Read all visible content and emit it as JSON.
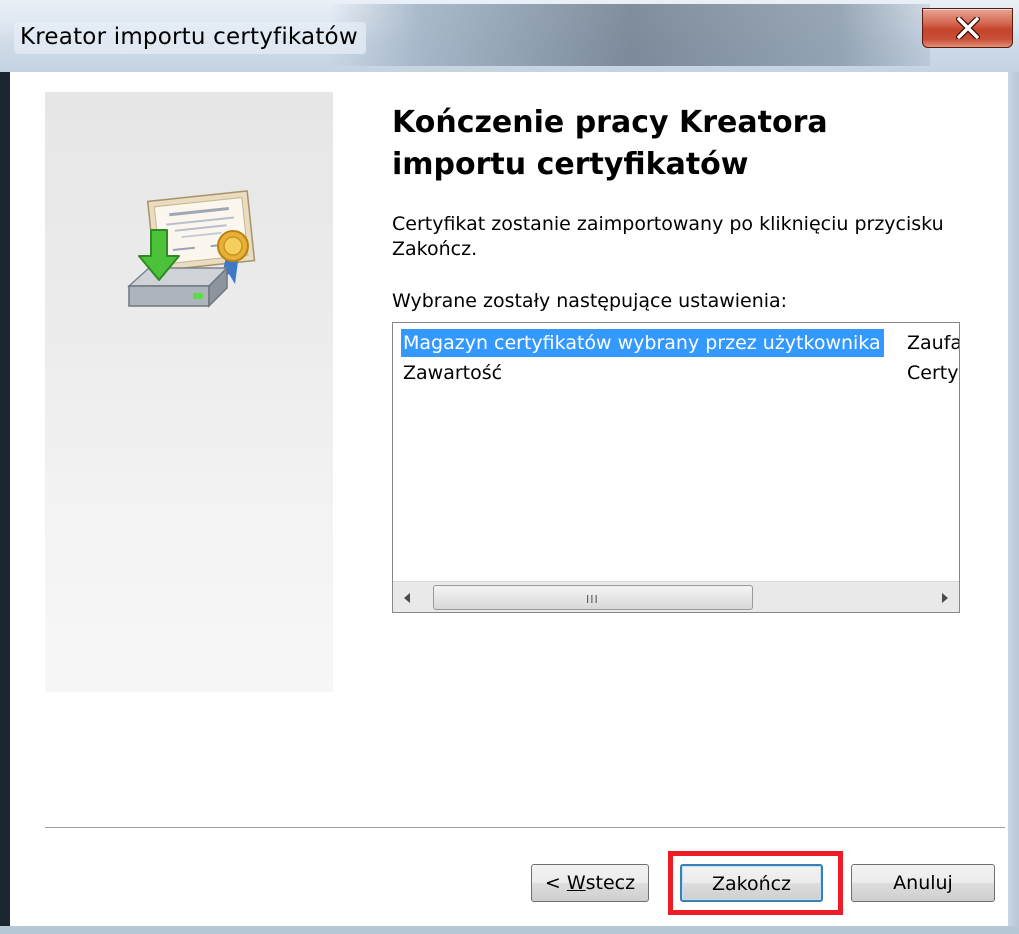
{
  "window": {
    "title": "Kreator importu certyfikatów"
  },
  "main": {
    "heading": "Kończenie pracy Kreatora importu certyfikatów",
    "description": "Certyfikat zostanie zaimportowany po kliknięciu przycisku Zakończ.",
    "settings_label": "Wybrane zostały następujące ustawienia:",
    "settings": [
      {
        "name": "Magazyn certyfikatów wybrany przez użytkownika",
        "value": "Zaufa"
      },
      {
        "name": "Zawartość",
        "value": "Certy"
      }
    ],
    "scroll_grip": "III"
  },
  "buttons": {
    "back_prefix": "< ",
    "back_mnemonic": "W",
    "back_rest": "stecz",
    "finish": "Zakończ",
    "cancel": "Anuluj"
  },
  "icons": {
    "close": "close-x-icon",
    "illustration": "certificate-import-icon"
  },
  "colors": {
    "selection": "#3399ff",
    "highlight_box": "#ee1c24",
    "close_button": "#c4432b"
  }
}
